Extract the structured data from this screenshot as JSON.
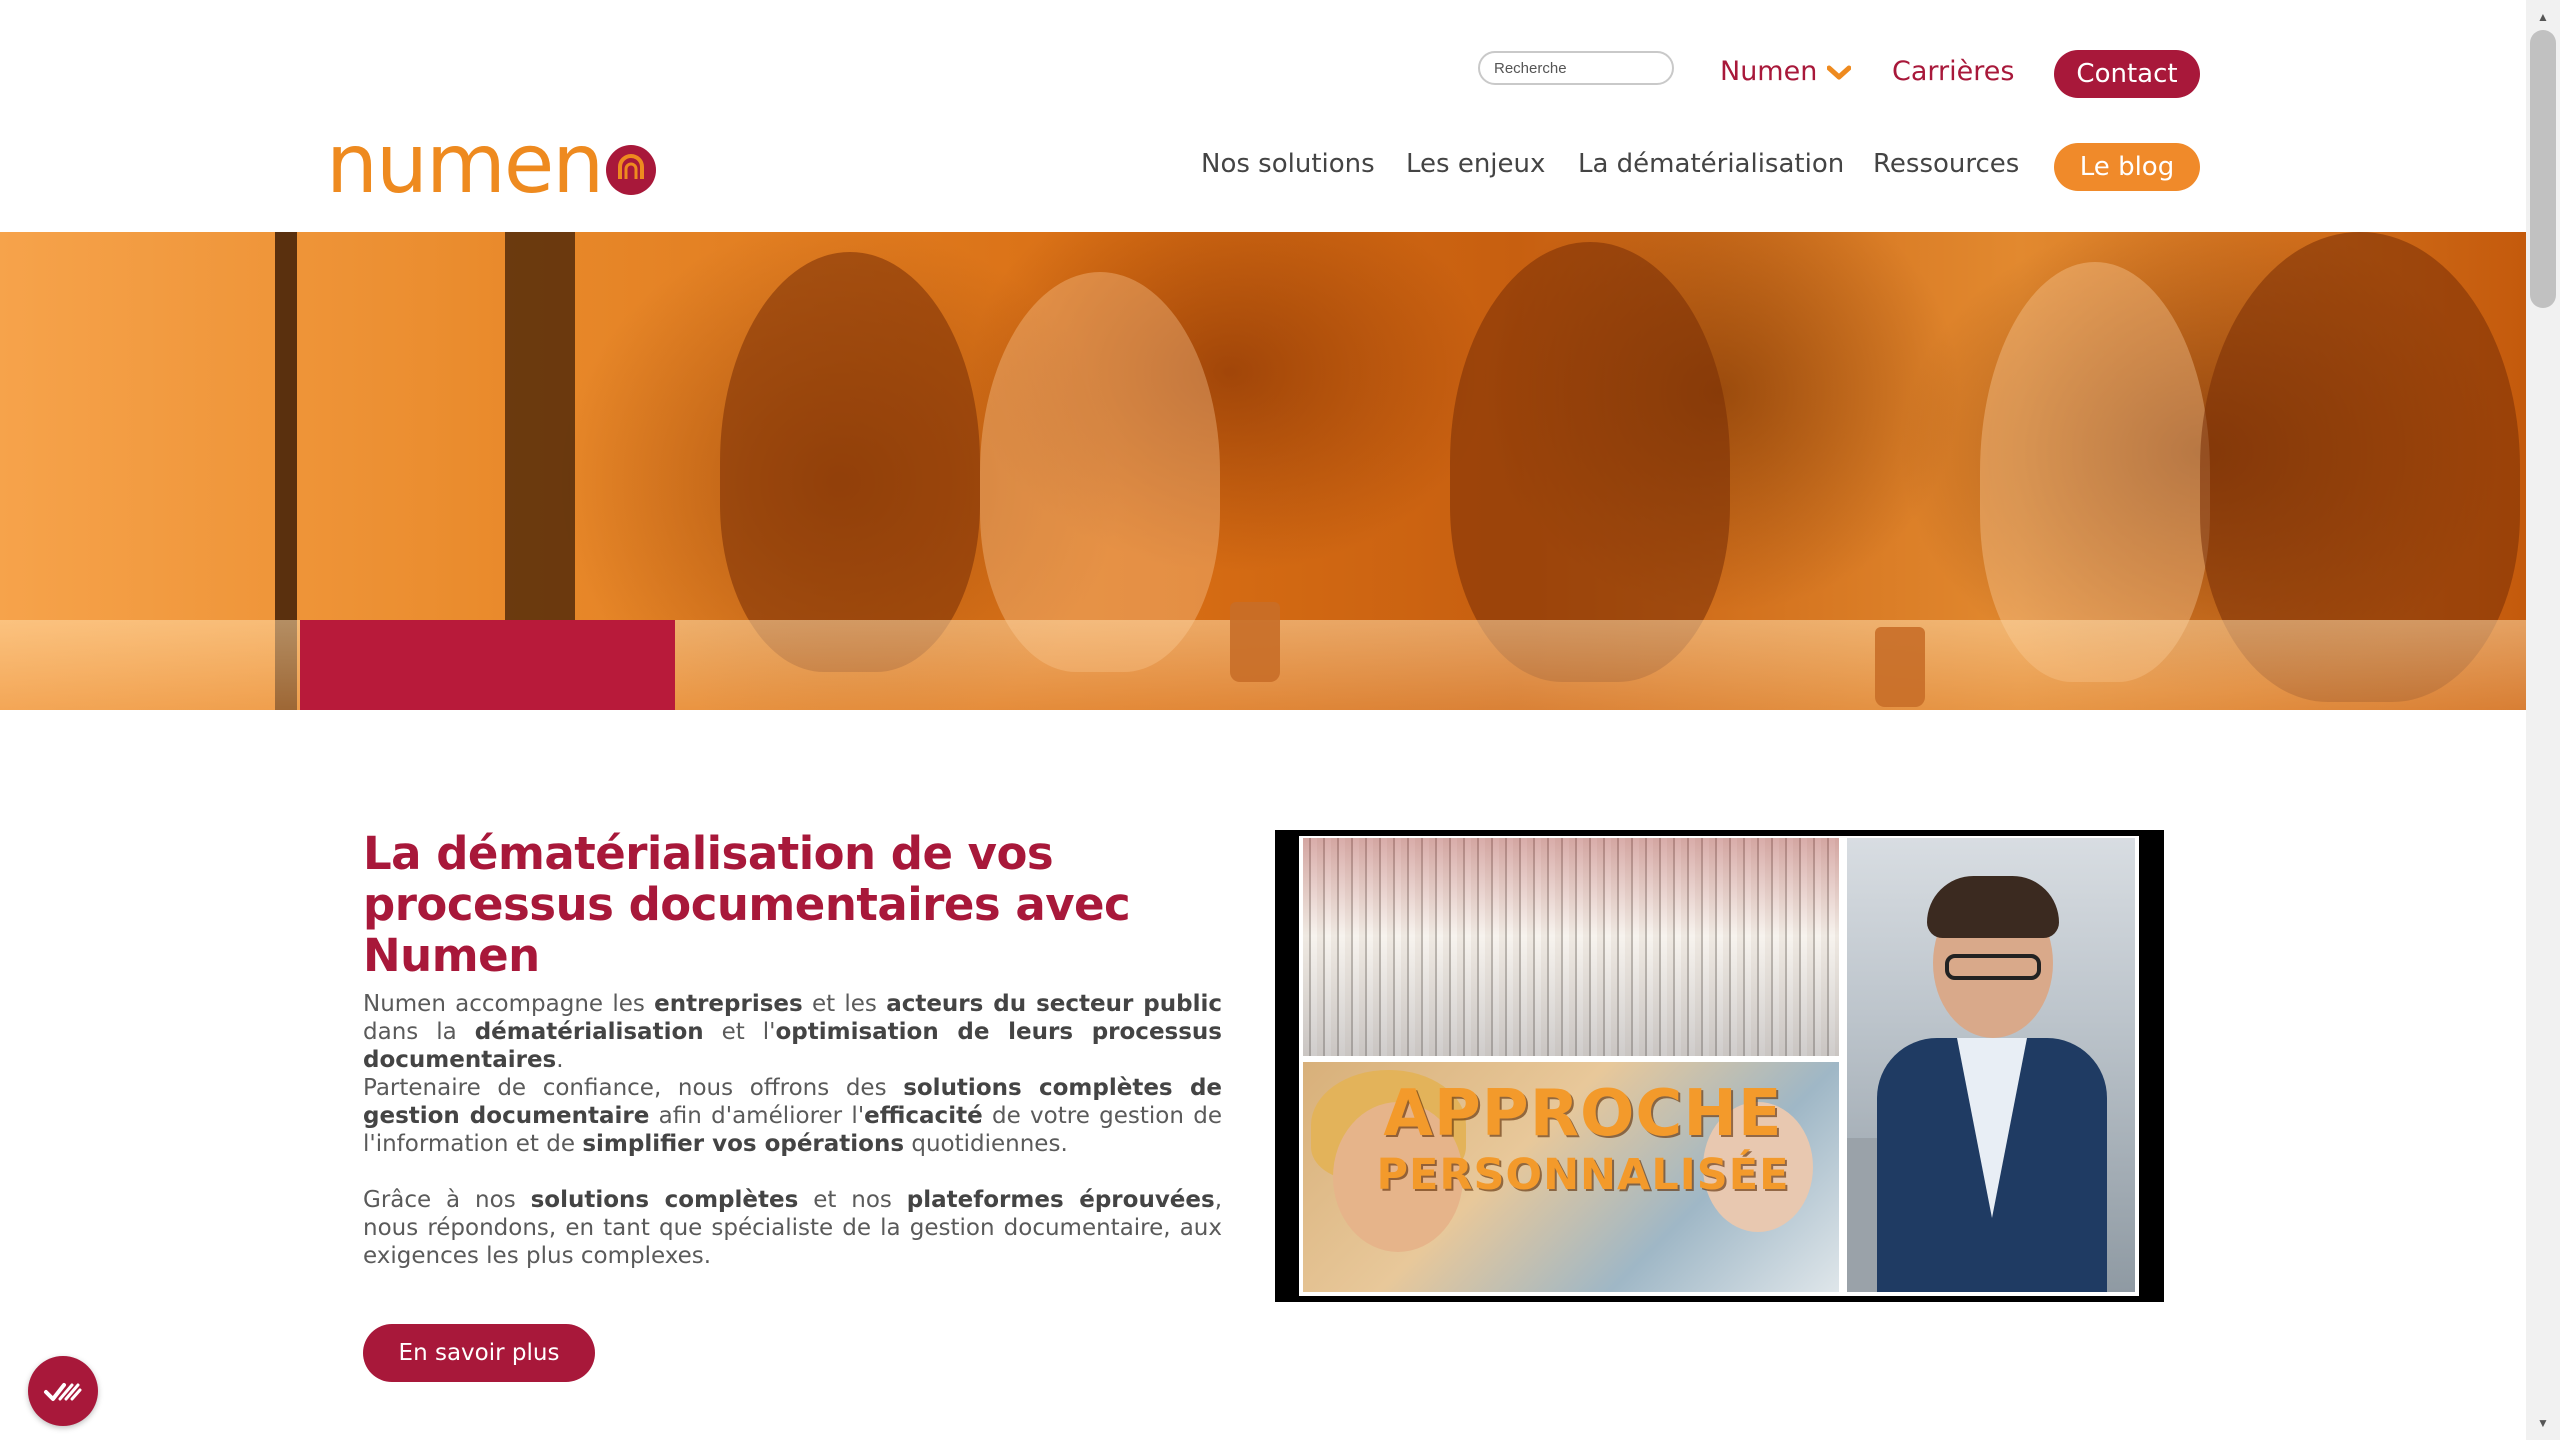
{
  "header": {
    "search": {
      "placeholder": "Recherche"
    },
    "top_links": {
      "numen": "Numen",
      "careers": "Carrières"
    },
    "contact_label": "Contact",
    "logo_text": "numen",
    "nav": [
      "Nos solutions",
      "Les enjeux",
      "La dématérialisation",
      "Ressources"
    ],
    "blog_label": "Le blog"
  },
  "main": {
    "headline": "La dématérialisation de vos processus documentaires avec Numen",
    "para1": {
      "t1": "Numen accompagne les ",
      "b1": "entreprises",
      "t2": " et les ",
      "b2": "acteurs du secteur public",
      "t3": " dans la ",
      "b3": "dématérialisation",
      "t4": " et l'",
      "b4": "optimisation de leurs processus documentaires",
      "t5": "."
    },
    "para2": {
      "t1": "Partenaire de confiance, nous offrons des ",
      "b1": "solutions complètes de gestion documentaire",
      "t2": " afin d'améliorer l'",
      "b2": "efficacité",
      "t3": " de votre gestion de l'information et de ",
      "b3": "simplifier vos opérations",
      "t4": " quotidiennes."
    },
    "para3": {
      "t1": "Grâce à nos ",
      "b1": "solutions complètes",
      "t2": " et nos ",
      "b2": "plateformes éprouvées",
      "t3": ", nous répondons, en tant que spécialiste de la gestion documentaire, aux exigences les plus complexes."
    },
    "cta_label": "En savoir plus",
    "video": {
      "line1": "APPROCHE",
      "line2": "PERSONNALISÉE"
    }
  },
  "colors": {
    "brand_red": "#a8183a",
    "brand_orange": "#ee8a1f",
    "blog_orange": "#f08a2a"
  },
  "icons": {
    "numen_menu": "chevron-down-icon",
    "consent": "cookie-consent-icon",
    "logo": "numen-logo-mark-icon"
  }
}
